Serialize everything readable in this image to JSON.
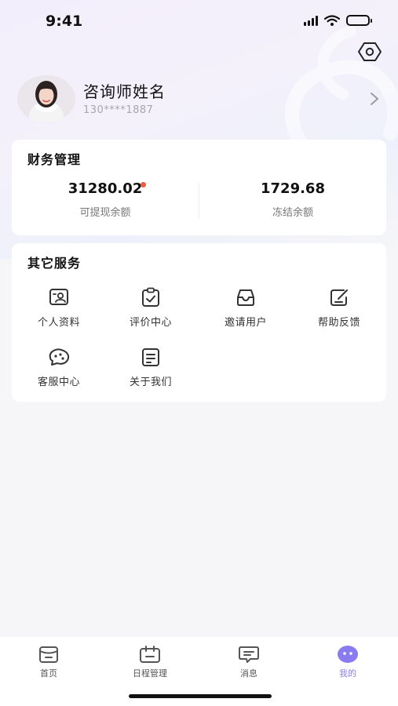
{
  "status_bar": {
    "time": "9:41"
  },
  "profile": {
    "name": "咨询师姓名",
    "phone": "130****1887"
  },
  "finance": {
    "title": "财务管理",
    "withdrawable": {
      "value": "31280.02",
      "label": "可提现余额"
    },
    "frozen": {
      "value": "1729.68",
      "label": "冻结余额"
    },
    "colors": {
      "badge": "#ef5c3c"
    }
  },
  "services": {
    "title": "其它服务",
    "items": [
      {
        "label": "个人资料",
        "icon": "profile-card-icon"
      },
      {
        "label": "评价中心",
        "icon": "clipboard-check-icon"
      },
      {
        "label": "邀请用户",
        "icon": "inbox-icon"
      },
      {
        "label": "帮助反馈",
        "icon": "edit-feedback-icon"
      },
      {
        "label": "客服中心",
        "icon": "customer-service-icon"
      },
      {
        "label": "关于我们",
        "icon": "document-icon"
      }
    ]
  },
  "tab_bar": {
    "tabs": [
      {
        "label": "首页",
        "icon": "home-icon",
        "active": false
      },
      {
        "label": "日程管理",
        "icon": "calendar-icon",
        "active": false
      },
      {
        "label": "消息",
        "icon": "message-icon",
        "active": false
      },
      {
        "label": "我的",
        "icon": "mine-icon",
        "active": true
      }
    ],
    "colors": {
      "active": "#8a7cf0",
      "inactive": "#555555"
    }
  }
}
